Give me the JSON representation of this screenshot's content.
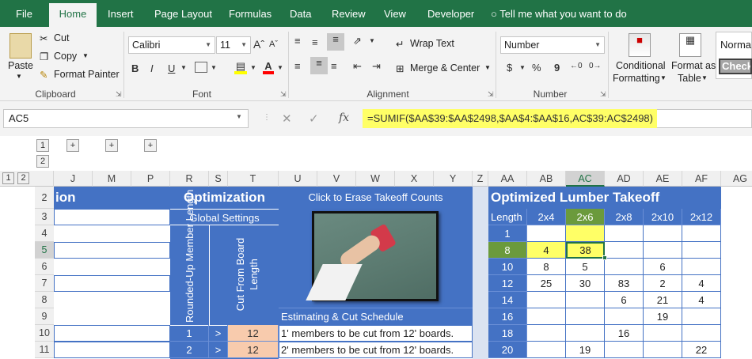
{
  "tabs": [
    "File",
    "Home",
    "Insert",
    "Page Layout",
    "Formulas",
    "Data",
    "Review",
    "View",
    "Developer"
  ],
  "tell_me": "Tell me what you want to do",
  "clipboard": {
    "paste": "Paste",
    "cut": "Cut",
    "copy": "Copy",
    "format_painter": "Format Painter",
    "group": "Clipboard"
  },
  "font": {
    "name": "Calibri",
    "size": "11",
    "bold": "B",
    "italic": "I",
    "underline": "U",
    "group": "Font"
  },
  "alignment": {
    "wrap_text": "Wrap Text",
    "merge_center": "Merge & Center",
    "group": "Alignment"
  },
  "number": {
    "format": "Number",
    "currency": "$",
    "percent": "%",
    "comma": "9",
    "group": "Number"
  },
  "styles": {
    "conditional": "Conditional",
    "conditional2": "Formatting",
    "format_as": "Format as",
    "format_as2": "Table",
    "normal": "Norma",
    "check": "Check"
  },
  "formula_bar": {
    "name_box": "AC5",
    "fx": "fx",
    "formula": "=SUMIF($AA$39:$AA$2498,$AA$4:$AA$16,AC$39:AC$2498)"
  },
  "outline": {
    "level1": "1",
    "level2": "2",
    "expand": "+",
    "row_level1": "1",
    "row_level2": "2"
  },
  "columns": [
    "J",
    "M",
    "P",
    "R",
    "S",
    "T",
    "U",
    "V",
    "W",
    "X",
    "Y",
    "Z",
    "AA",
    "AB",
    "AC",
    "AD",
    "AE",
    "AF",
    "AG"
  ],
  "rows": [
    "2",
    "3",
    "4",
    "5",
    "6",
    "7",
    "8",
    "9",
    "10",
    "11"
  ],
  "sheet": {
    "ion": "ion",
    "optimization": "Optimization",
    "global_settings": "Global Settings",
    "rounded_up": "Rounded-Up Member Length",
    "cut_from": "Cut From Board Length",
    "click_erase": "Click to Erase Takeoff Counts",
    "estimating": "Estimating & Cut Schedule",
    "row10": {
      "r": "1",
      "s": ">",
      "t": "12",
      "u": "1' members to be cut from 12' boards."
    },
    "row11": {
      "r": "2",
      "s": ">",
      "t": "12",
      "u": "2' members to be cut from 12' boards."
    },
    "takeoff_title": "Optimized Lumber Takeoff",
    "length_header": "Length",
    "sizes": [
      "2x4",
      "2x6",
      "2x8",
      "2x10",
      "2x12"
    ],
    "takeoff": [
      {
        "len": "1",
        "v": [
          "",
          "",
          "",
          "",
          ""
        ]
      },
      {
        "len": "8",
        "v": [
          "4",
          "38",
          "",
          "",
          ""
        ]
      },
      {
        "len": "10",
        "v": [
          "8",
          "5",
          "",
          "6",
          ""
        ]
      },
      {
        "len": "12",
        "v": [
          "25",
          "30",
          "83",
          "2",
          "4"
        ]
      },
      {
        "len": "14",
        "v": [
          "",
          "",
          "6",
          "21",
          "4"
        ]
      },
      {
        "len": "16",
        "v": [
          "",
          "",
          "",
          "19",
          ""
        ]
      },
      {
        "len": "18",
        "v": [
          "",
          "",
          "16",
          "",
          ""
        ]
      },
      {
        "len": "20",
        "v": [
          "",
          "19",
          "",
          "",
          "22"
        ]
      }
    ]
  }
}
